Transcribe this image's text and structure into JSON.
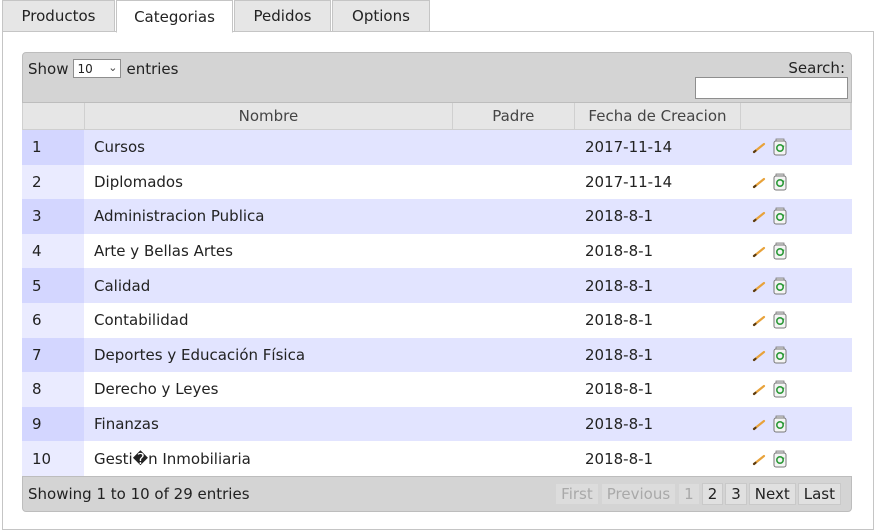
{
  "tabs": [
    {
      "label": "Productos",
      "active": false
    },
    {
      "label": "Categorias",
      "active": true
    },
    {
      "label": "Pedidos",
      "active": false
    },
    {
      "label": "Options",
      "active": false
    }
  ],
  "toolbar": {
    "show_label": "Show",
    "length_value": "10",
    "entries_label": "entries",
    "search_label": "Search:",
    "search_value": ""
  },
  "table": {
    "columns": [
      "",
      "Nombre",
      "Padre",
      "Fecha de Creacion",
      ""
    ],
    "rows": [
      {
        "id": "1",
        "nombre": "Cursos",
        "padre": "",
        "fecha": "2017-11-14"
      },
      {
        "id": "2",
        "nombre": "Diplomados",
        "padre": "",
        "fecha": "2017-11-14"
      },
      {
        "id": "3",
        "nombre": "Administracion Publica",
        "padre": "",
        "fecha": "2018-8-1"
      },
      {
        "id": "4",
        "nombre": "Arte y Bellas Artes",
        "padre": "",
        "fecha": "2018-8-1"
      },
      {
        "id": "5",
        "nombre": "Calidad",
        "padre": "",
        "fecha": "2018-8-1"
      },
      {
        "id": "6",
        "nombre": "Contabilidad",
        "padre": "",
        "fecha": "2018-8-1"
      },
      {
        "id": "7",
        "nombre": "Deportes y Educación Física",
        "padre": "",
        "fecha": "2018-8-1"
      },
      {
        "id": "8",
        "nombre": "Derecho y Leyes",
        "padre": "",
        "fecha": "2018-8-1"
      },
      {
        "id": "9",
        "nombre": "Finanzas",
        "padre": "",
        "fecha": "2018-8-1"
      },
      {
        "id": "10",
        "nombre": "Gesti�n Inmobiliaria",
        "padre": "",
        "fecha": "2018-8-1"
      }
    ],
    "row_actions": [
      "pencil-icon",
      "recycle-bin-icon"
    ]
  },
  "footer": {
    "info": "Showing 1 to 10 of 29 entries",
    "pager": {
      "first": "First",
      "previous": "Previous",
      "pages": [
        "1",
        "2",
        "3"
      ],
      "current_page": "1",
      "next": "Next",
      "last": "Last"
    }
  },
  "colors": {
    "row_odd": "#e2e4ff",
    "row_even": "#ffffff",
    "header_bg": "#d4d4d4",
    "accent_pencil": "#e8a23a",
    "accent_recycle": "#2e9a3a"
  }
}
